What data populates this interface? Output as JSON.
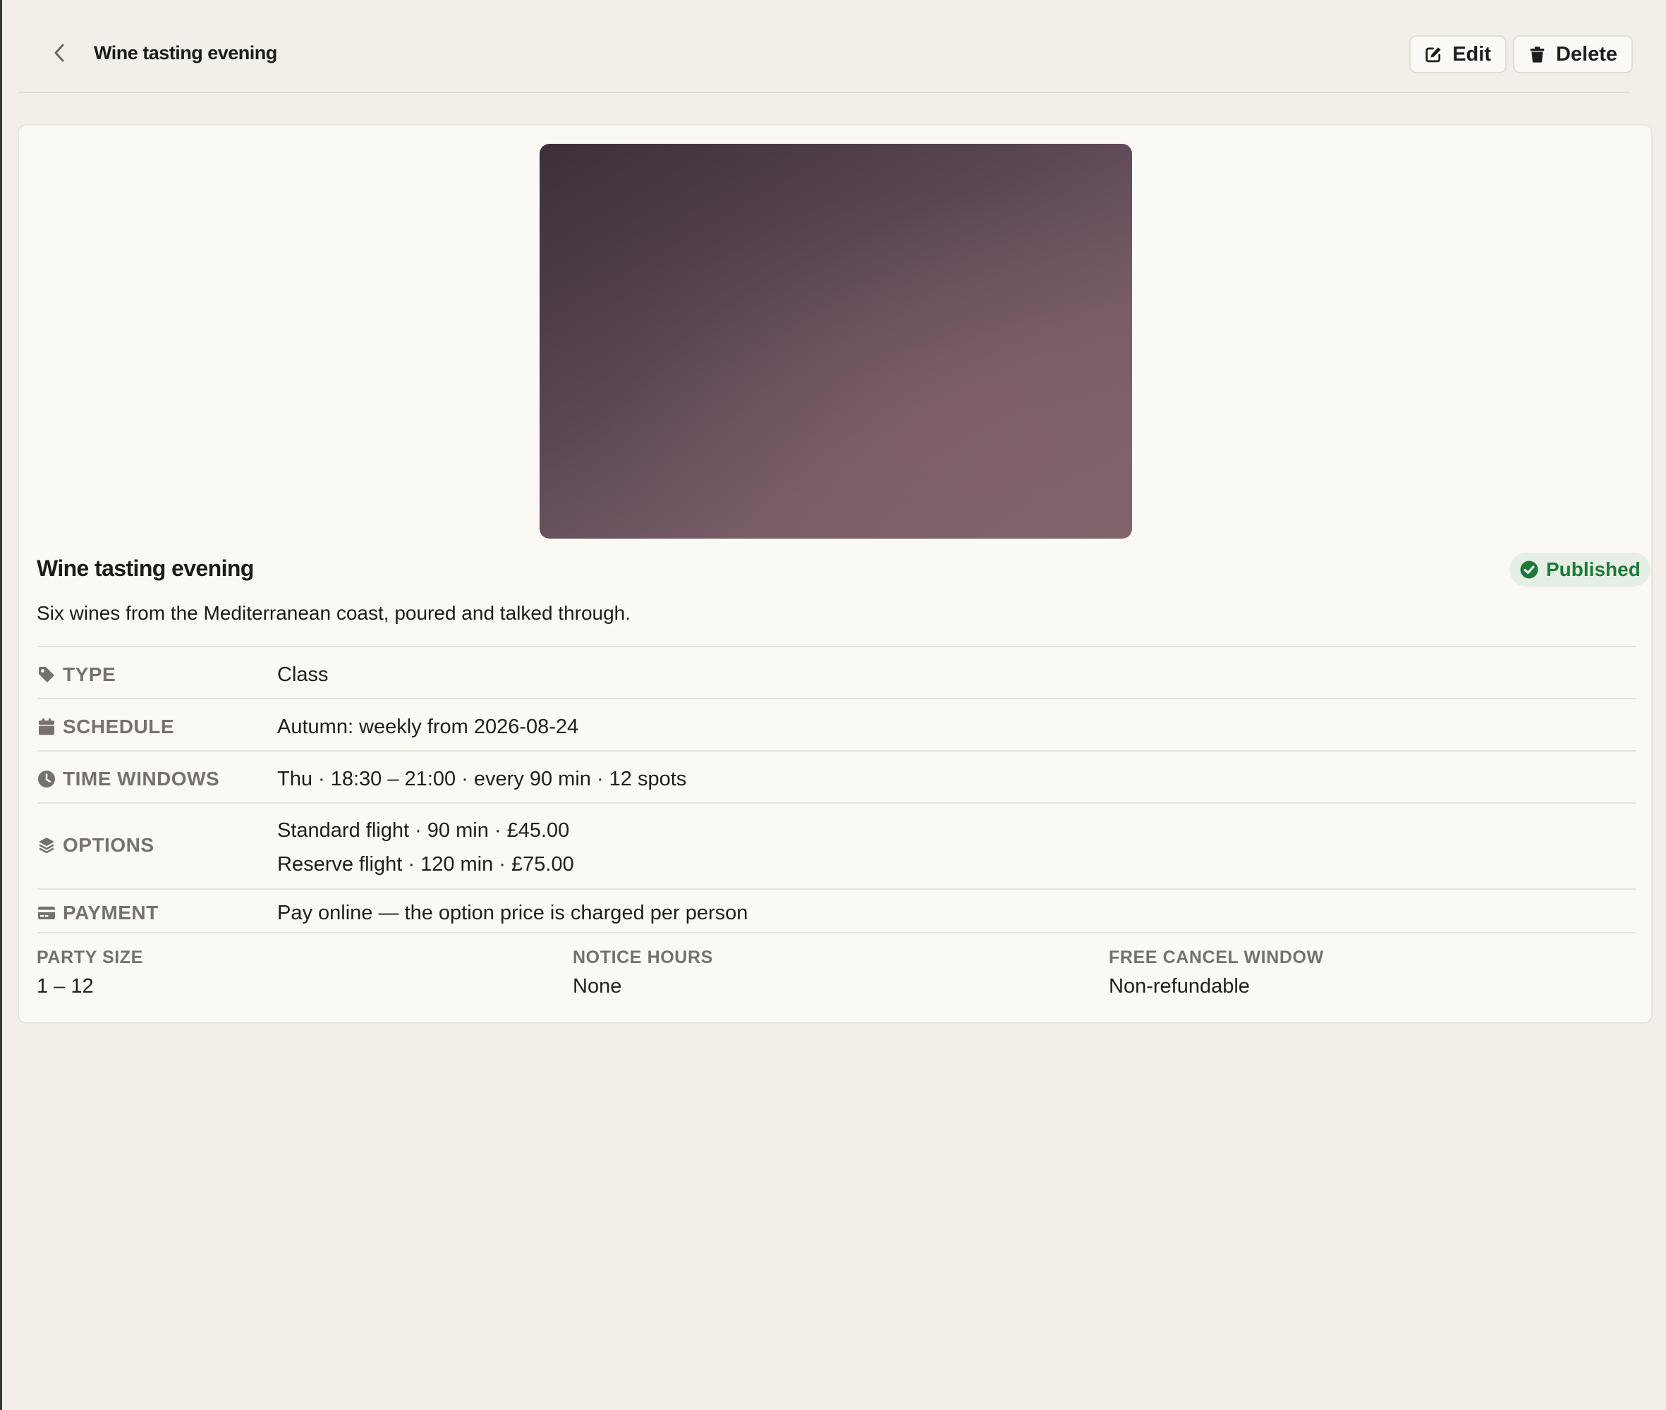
{
  "header": {
    "title": "Wine tasting evening",
    "edit_label": "Edit",
    "delete_label": "Delete"
  },
  "experience": {
    "title": "Wine tasting evening",
    "status": "Published",
    "description": "Six wines from the Mediterranean coast, poured and talked through."
  },
  "details": {
    "type": {
      "label": "TYPE",
      "value": "Class"
    },
    "schedule": {
      "label": "SCHEDULE",
      "value": "Autumn: weekly from 2026-08-24"
    },
    "time_windows": {
      "label": "TIME WINDOWS",
      "value": "Thu · 18:30 – 21:00 · every 90 min · 12 spots"
    },
    "options": {
      "label": "OPTIONS",
      "values": [
        "Standard flight · 90 min · £45.00",
        "Reserve flight · 120 min · £75.00"
      ]
    },
    "payment": {
      "label": "PAYMENT",
      "value": "Pay online — the option price is charged per person"
    }
  },
  "stats": [
    {
      "label": "PARTY SIZE",
      "value": "1 – 12"
    },
    {
      "label": "NOTICE HOURS",
      "value": "None"
    },
    {
      "label": "FREE CANCEL WINDOW",
      "value": "Non-refundable"
    }
  ],
  "icons": {
    "back": "chevron-left-icon",
    "edit": "edit-icon",
    "delete": "trash-icon",
    "status": "check-circle-icon",
    "type": "tag-icon",
    "schedule": "calendar-icon",
    "time_windows": "clock-icon",
    "options": "layers-icon",
    "payment": "credit-card-icon"
  },
  "colors": {
    "status_text": "#1e7a3a",
    "status_bg": "#e5efe4",
    "label": "#76716a"
  }
}
